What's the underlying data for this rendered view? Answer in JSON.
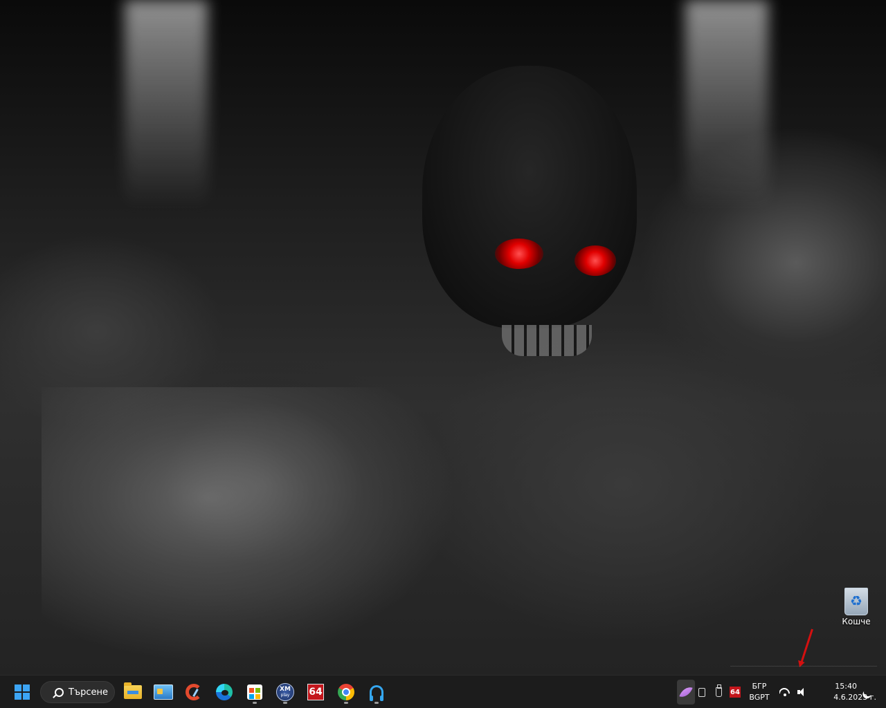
{
  "desktop": {
    "icons": [
      {
        "label": "Кошче",
        "icon": "recycle-bin-icon"
      }
    ]
  },
  "taskbar": {
    "search_label": "Търсене",
    "apps": [
      {
        "name": "file-explorer",
        "icon": "folder-icon",
        "running": false
      },
      {
        "name": "control-panel",
        "icon": "control-panel-icon",
        "running": false
      },
      {
        "name": "ccleaner",
        "icon": "ccleaner-icon",
        "running": false
      },
      {
        "name": "edge",
        "icon": "edge-icon",
        "running": false
      },
      {
        "name": "microsoft-store",
        "icon": "store-icon",
        "running": true
      },
      {
        "name": "xmplay",
        "icon": "xmplay-icon",
        "running": true
      },
      {
        "name": "aida64",
        "icon": "aida64-icon",
        "running": false
      },
      {
        "name": "chrome",
        "icon": "chrome-icon",
        "running": true
      },
      {
        "name": "headset-app",
        "icon": "headset-icon",
        "running": true
      }
    ],
    "xmplay_text": "XM",
    "xmplay_subtext": "play",
    "aida_text": "64",
    "tray": {
      "aida_text": "64",
      "lang_top": "БГР",
      "lang_bottom": "BGPT",
      "time": "15:40",
      "date": "4.6.2023 г."
    }
  },
  "colors": {
    "taskbar_bg": "#1c1c1c",
    "accent": "#3ca5f5",
    "eye_red": "#e00000",
    "annotation_arrow": "#d41010"
  }
}
